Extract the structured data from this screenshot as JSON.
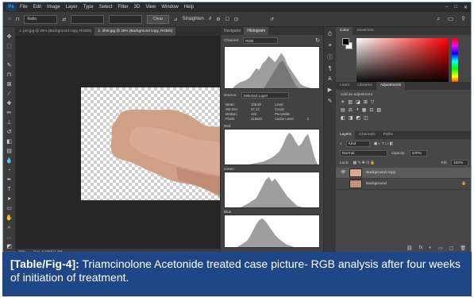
{
  "menubar": {
    "logo": "Ps",
    "items": [
      "File",
      "Edit",
      "Image",
      "Layer",
      "Type",
      "Select",
      "Filter",
      "3D",
      "View",
      "Window",
      "Help"
    ]
  },
  "options": {
    "ratio": "Ratio",
    "clear": "Clear",
    "straighten": "Straighten",
    "icons": [
      "home-icon",
      "crop-icon",
      "swap-icon",
      "grid-icon",
      "gear-icon",
      "delete-icon",
      "content-aware-icon",
      "reset-icon"
    ],
    "right_icons": [
      "search-icon",
      "workspace-icon",
      "share-icon"
    ]
  },
  "tabs": [
    {
      "label": "1. pre.jpg @ 25% (Background copy, RGB/8)",
      "active": false
    },
    {
      "label": "2. 3hrtr.jpg @ 25% (Background copy, RGB/8)",
      "active": true
    }
  ],
  "status": {
    "zoom": "25%",
    "doc": "Doc: 5.93M/11.9M"
  },
  "histogram": {
    "tabs": [
      "Navigator",
      "Histogram"
    ],
    "channel_label": "Channel:",
    "channel_value": "RGB",
    "source_label": "Source:",
    "source_value": "Selected Layer",
    "stats": [
      [
        "Mean:",
        "108.80",
        "Level:",
        ""
      ],
      [
        "Std Dev:",
        "57.12",
        "Count:",
        ""
      ],
      [
        "Median:",
        "132",
        "Percentile:",
        ""
      ],
      [
        "Pixels:",
        "215520",
        "Cache Level:",
        "2"
      ]
    ],
    "channels": [
      "Red",
      "Green",
      "Blue"
    ]
  },
  "color_panel": {
    "tabs": [
      "Color",
      "Swatches"
    ],
    "foreground": "#000000",
    "background": "#ffffff"
  },
  "adjustments": {
    "tabs": [
      "Learn",
      "Libraries",
      "Adjustments"
    ],
    "add_label": "Add an adjustment",
    "row1": [
      "☀",
      "▥",
      "◪",
      "⊞",
      "▽"
    ],
    "row2": [
      "▤",
      "⚖",
      "◑",
      "▦",
      "⊡",
      "▨"
    ],
    "row3": [
      "◧",
      "◨",
      "◩",
      "◫"
    ]
  },
  "layers": {
    "tabs": [
      "Layers",
      "Channels",
      "Paths"
    ],
    "kind": "Kind",
    "blend": "Normal",
    "opacity_label": "Opacity:",
    "opacity": "100%",
    "lock_label": "Lock:",
    "fill_label": "Fill:",
    "fill": "100%",
    "items": [
      {
        "name": "Background copy",
        "selected": true
      },
      {
        "name": "Background",
        "selected": false
      }
    ],
    "bottom_icons": [
      "fx",
      "◐",
      "▭",
      "▢",
      "🗑"
    ]
  },
  "caption": {
    "label": "[Table/Fig-4]:",
    "text": " Triamcinolone Acetonide treated case picture- RGB analysis after four weeks of initiation of treatment."
  },
  "colors": {
    "caption_bg": "#1f4787",
    "ui_dark": "#535353",
    "skin": "#d9a98e"
  }
}
